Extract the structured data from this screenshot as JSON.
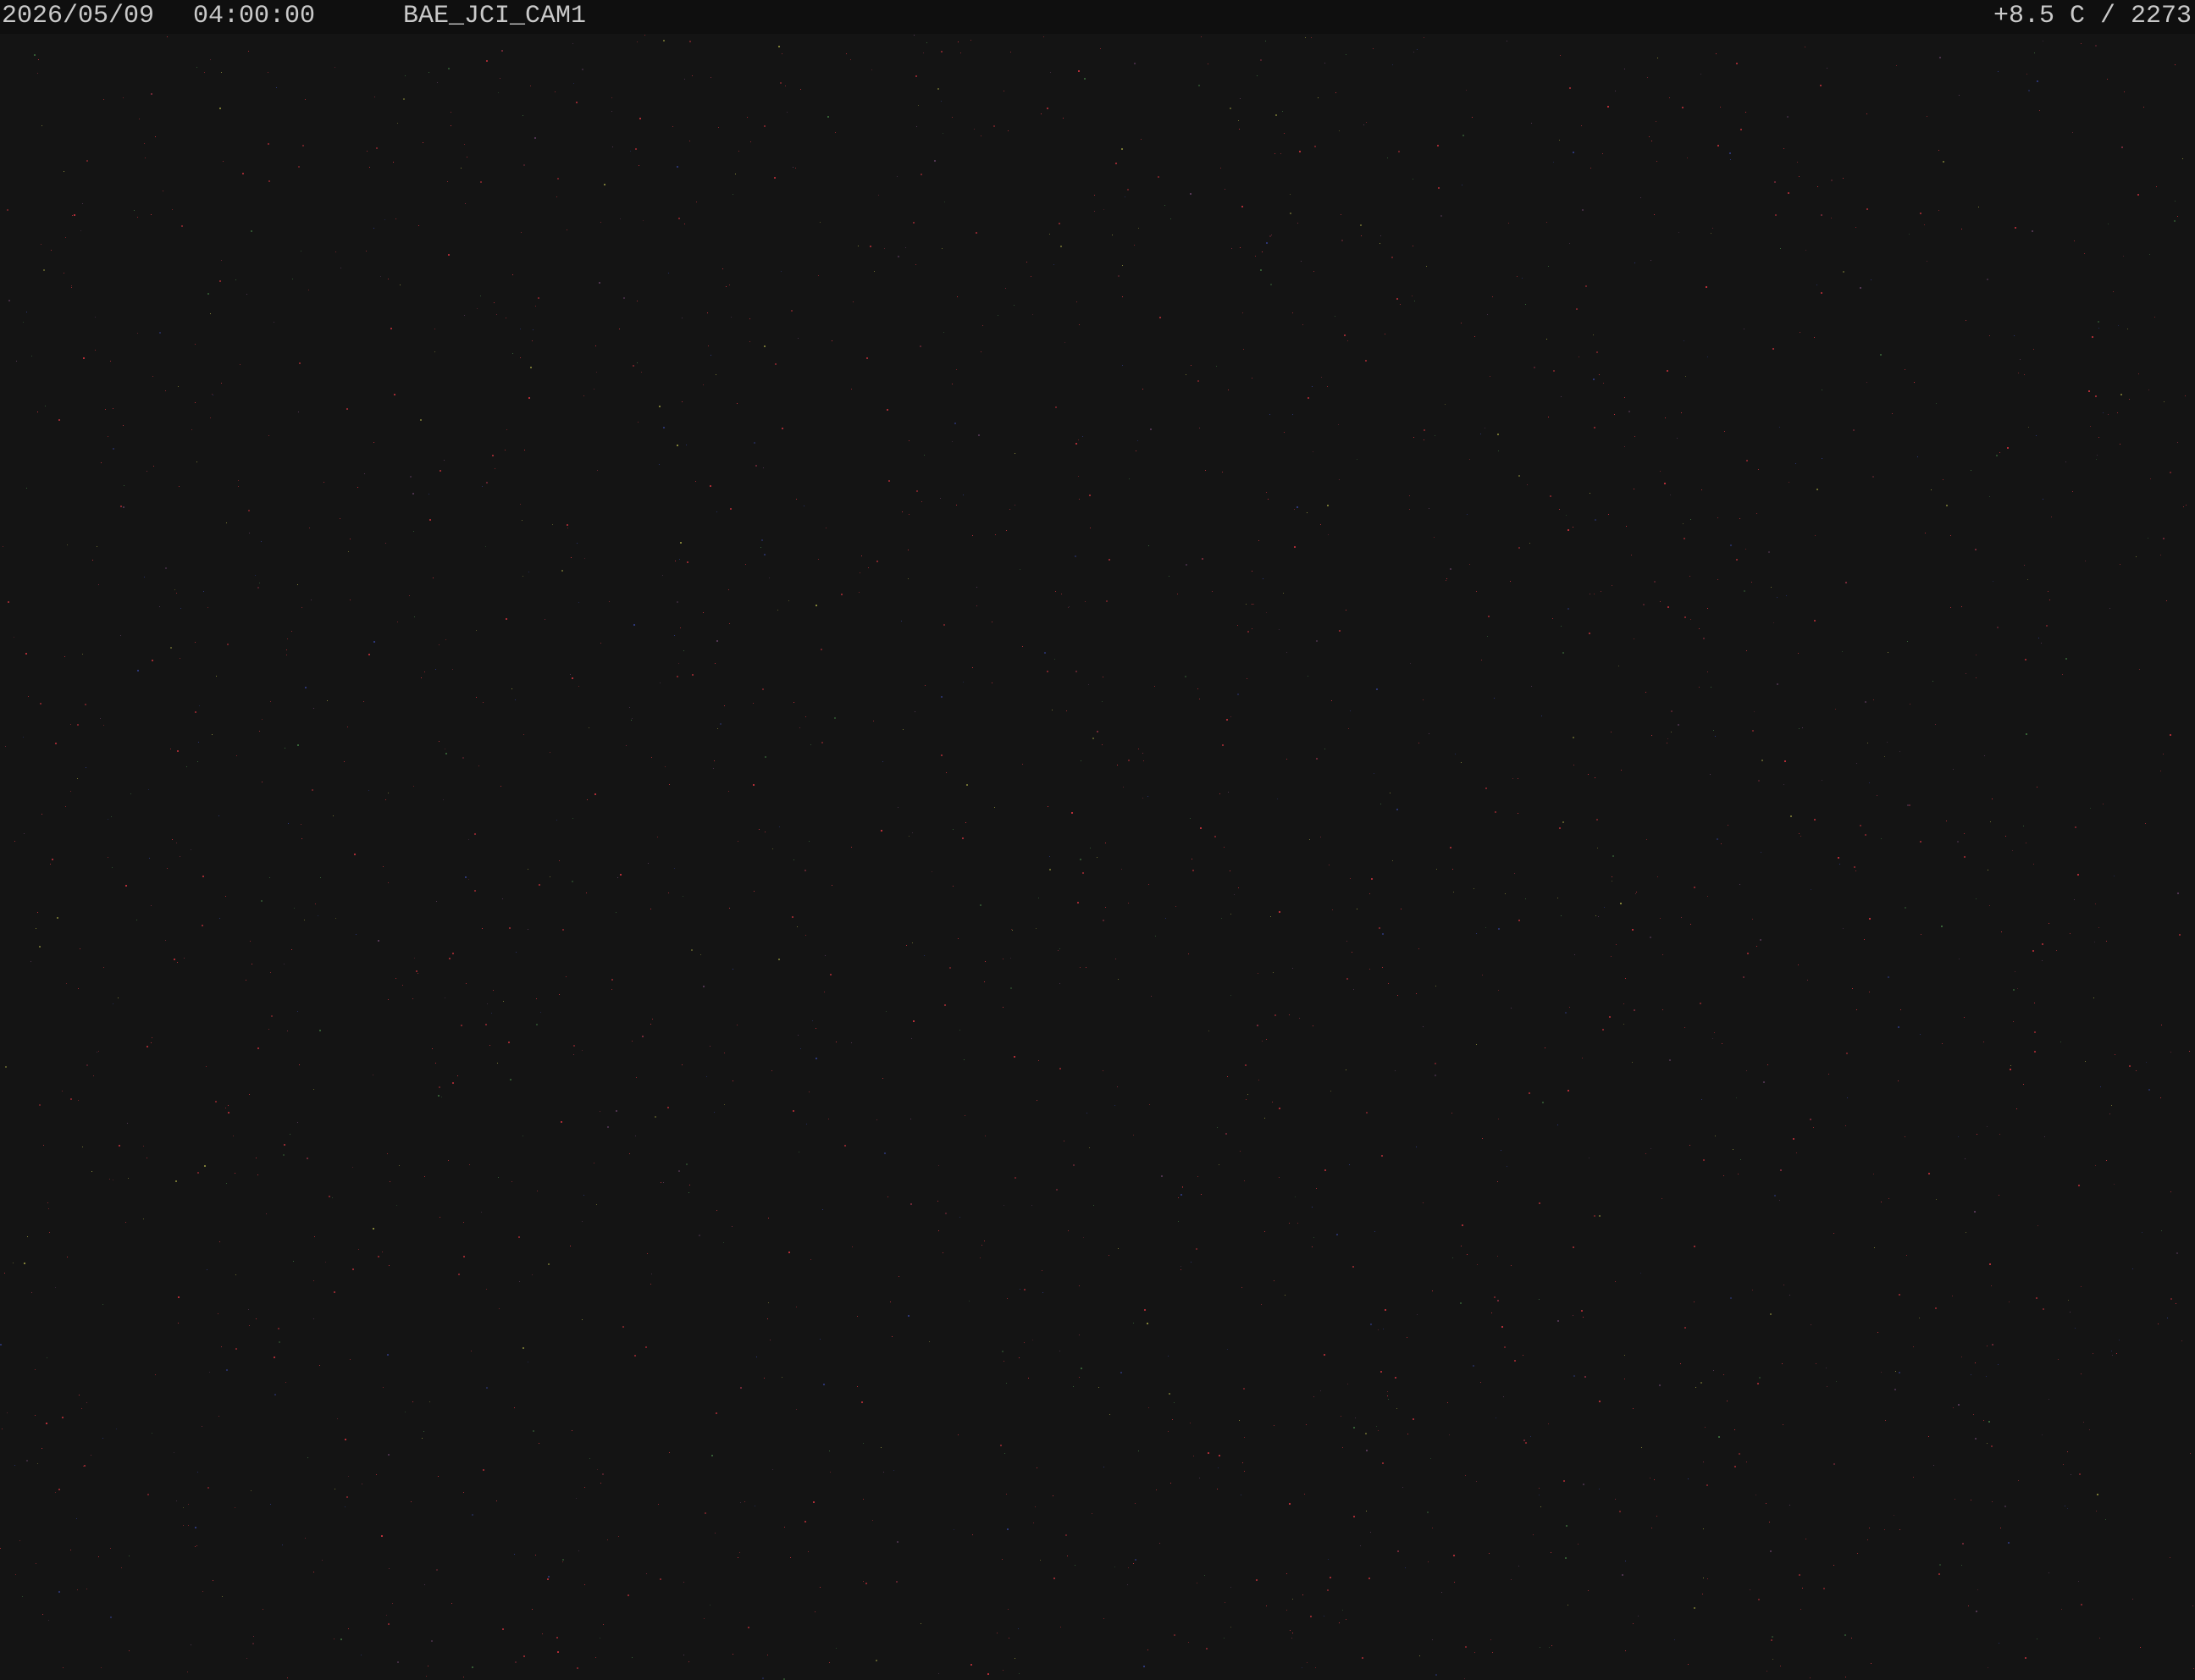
{
  "overlay": {
    "date": "2026/05/09",
    "time": "04:00:00",
    "camera_id": "BAE_JCI_CAM1",
    "readout": "+8.5 C / 2273"
  },
  "view": {
    "background_color": "#141414",
    "noise_colors": [
      "#c0303a",
      "#7a2a3a",
      "#2f3a80",
      "#3a6a3a",
      "#8a8a3a",
      "#5a3a5a"
    ]
  }
}
